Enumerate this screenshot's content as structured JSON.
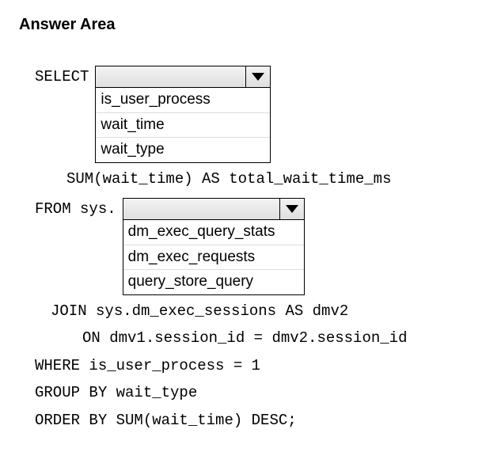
{
  "title": "Answer Area",
  "code": {
    "select": "SELECT",
    "sum_line": "SUM(wait_time) AS total_wait_time_ms",
    "from": "FROM sys.",
    "join": "JOIN sys.dm_exec_sessions AS dmv2",
    "on": "ON dmv1.session_id = dmv2.session_id",
    "where": "WHERE is_user_process = 1",
    "groupby": "GROUP BY wait_type",
    "orderby": "ORDER BY SUM(wait_time) DESC;"
  },
  "dropdown1": {
    "items": [
      "is_user_process",
      "wait_time",
      "wait_type"
    ]
  },
  "dropdown2": {
    "items": [
      "dm_exec_query_stats",
      "dm_exec_requests",
      "query_store_query"
    ]
  }
}
